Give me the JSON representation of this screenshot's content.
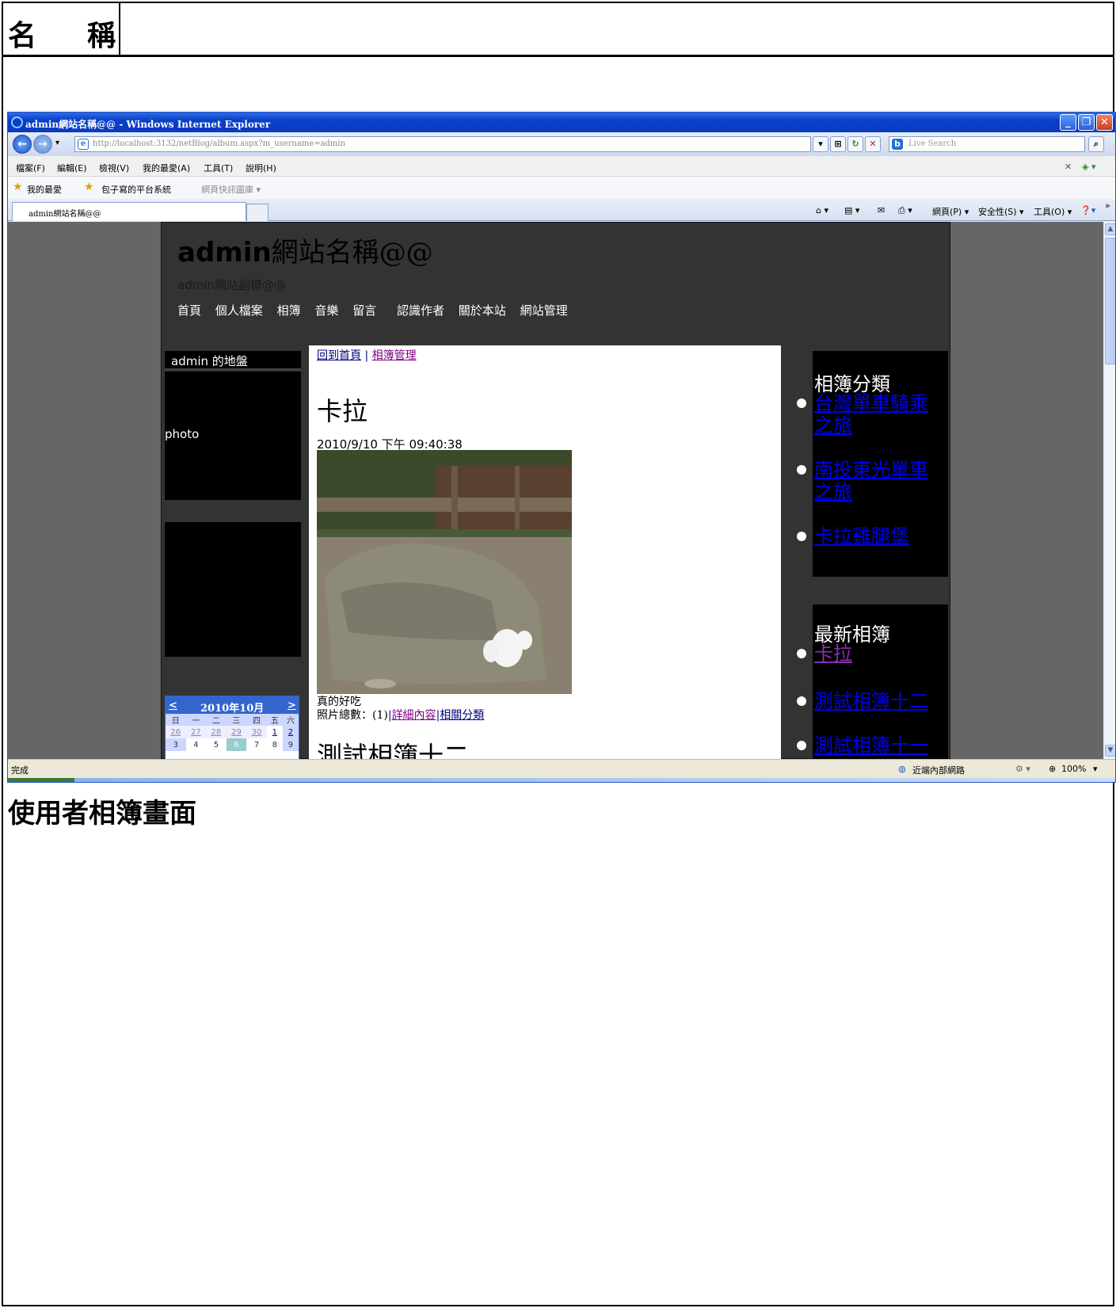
{
  "doc": {
    "name_label_a": "名",
    "name_label_b": "稱",
    "caption": "使用者相簿畫面"
  },
  "browser": {
    "title": "admin網站名稱@@ - Windows Internet Explorer",
    "url": "http://localhost:3132/netBlog/album.aspx?m_username=admin",
    "search_placeholder": "Live Search",
    "menu": [
      "檔案(F)",
      "編輯(E)",
      "檢視(V)",
      "我的最愛(A)",
      "工具(T)",
      "說明(H)"
    ],
    "favorites_label": "我的最愛",
    "fav_links": [
      "包子寫的平台系統",
      "網頁快訊圖庫 ▾"
    ],
    "tab_title": "admin網站名稱@@",
    "tab_tools": [
      "網頁(P) ▾",
      "安全性(S) ▾",
      "工具(O) ▾"
    ],
    "status_text": "完成",
    "status_zone": "近端內部網路",
    "zoom": "100%"
  },
  "site": {
    "title_bold": "admin",
    "title_rest": "網站名稱@@",
    "subtitle": "admin網站副標@@",
    "nav": [
      "首頁",
      "個人檔案",
      "相簿",
      "音樂",
      "留言",
      "認識作者",
      "關於本站",
      "網站管理"
    ],
    "left_head": "admin 的地盤",
    "photo_label": "photo",
    "calendar": {
      "title": "2010年10月",
      "prev": "<",
      "next": ">",
      "weekdays": [
        "日",
        "一",
        "二",
        "三",
        "四",
        "五",
        "六"
      ],
      "row1": [
        "26",
        "27",
        "28",
        "29",
        "30",
        "1",
        "2"
      ],
      "row2": [
        "3",
        "4",
        "5",
        "6",
        "7",
        "8",
        "9"
      ]
    },
    "center": {
      "link_home": "回到首頁",
      "separator": "|",
      "link_manage": "相簿管理",
      "album_title": "卡拉",
      "album_date": "2010/9/10 下午 09:40:38",
      "album_desc": "真的好吃",
      "photo_count": "照片總數：(1)",
      "link_detail": "詳細內容",
      "link_category": "相關分類",
      "next_album_title": "測試相簿十二"
    },
    "right": {
      "cat_heading": "相簿分類",
      "categories": [
        "台灣單車騎乘之旅",
        "南投東光單車之旅",
        "卡拉雞腿堡"
      ],
      "new_heading": "最新相簿",
      "newest": [
        "卡拉",
        "測試相簿十二",
        "測試相簿十一"
      ]
    }
  }
}
